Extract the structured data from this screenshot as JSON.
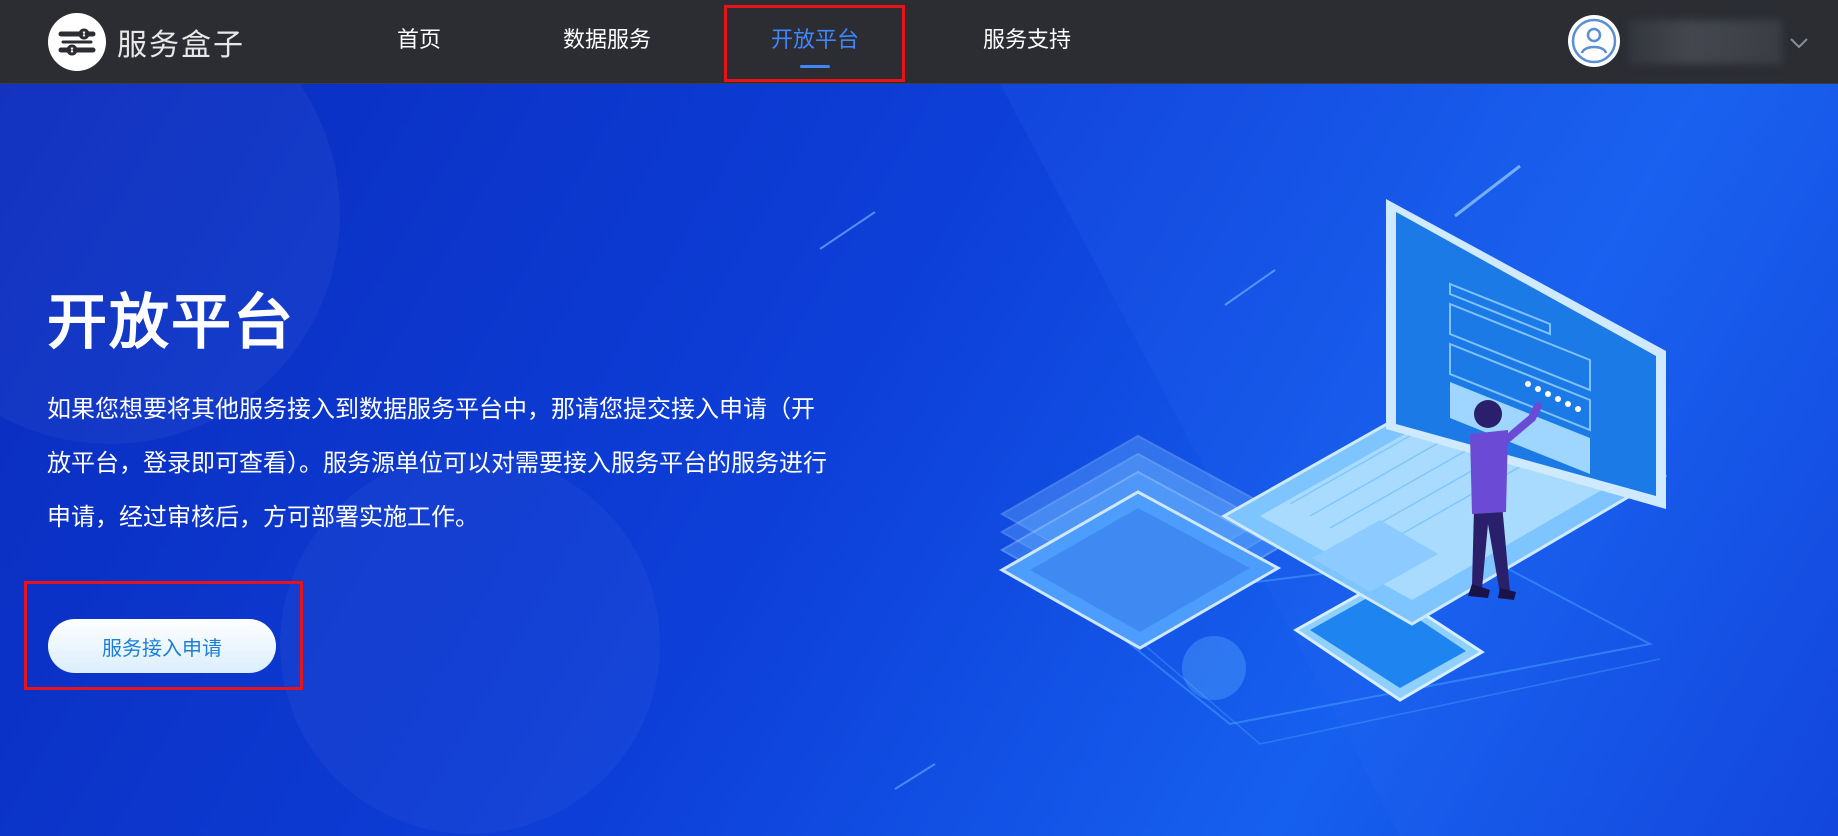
{
  "header": {
    "logo_text": "服务盒子",
    "nav": [
      {
        "label": "首页",
        "active": false
      },
      {
        "label": "数据服务",
        "active": false
      },
      {
        "label": "开放平台",
        "active": true
      },
      {
        "label": "服务支持",
        "active": false
      }
    ]
  },
  "hero": {
    "title": "开放平台",
    "description": "如果您想要将其他服务接入到数据服务平台中，那请您提交接入申请（开放平台，登录即可查看）。服务源单位可以对需要接入服务平台的服务进行申请，经过审核后，方可部署实施工作。",
    "button_label": "服务接入申请"
  },
  "colors": {
    "header_bg": "#2b2d33",
    "nav_active": "#3f86ff",
    "hero_bg": "#0d3fd8",
    "highlight": "#e5141b",
    "button_text": "#1b7fd6"
  },
  "icons": [
    "logo-icon",
    "user-avatar-icon",
    "chevron-down-icon"
  ]
}
